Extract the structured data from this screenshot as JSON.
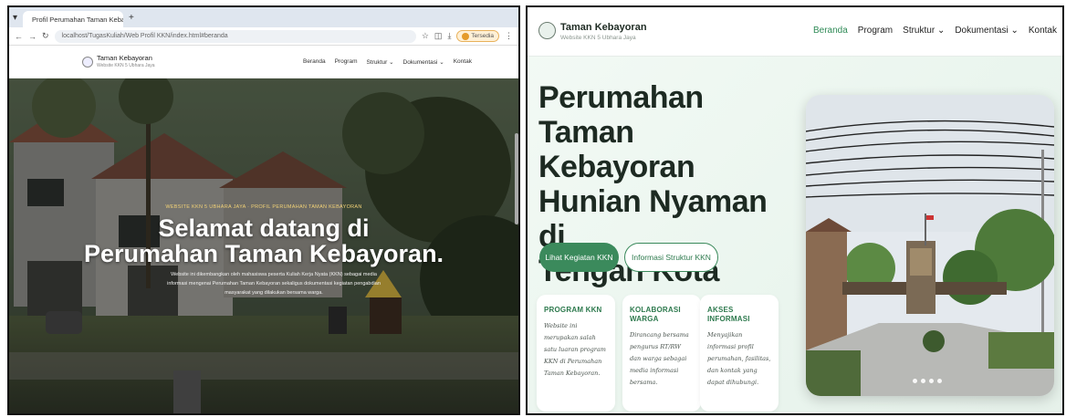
{
  "left": {
    "tab_title": "Profil Perumahan Taman Kebay",
    "tab_close": "×",
    "tab_add": "+",
    "address": "localhost/TugasKuliah/Web Profil KKN/index.html#beranda",
    "profile_label": "Tersedia",
    "nav": {
      "brand": "Taman Kebayoran",
      "sub": "Website KKN 5 Ubhara Jaya",
      "menu": [
        "Beranda",
        "Program",
        "Struktur ⌄",
        "Dokumentasi ⌄",
        "Kontak"
      ]
    },
    "hero": {
      "eyebrow": "WEBSITE KKN 5 UBHARA JAYA · PROFIL PERUMAHAN TAMAN KEBAYORAN",
      "title_line1": "Selamat datang di",
      "title_line2": "Perumahan Taman Kebayoran.",
      "desc": "Website ini dikembangkan oleh mahasiswa peserta Kuliah Kerja Nyata (KKN) sebagai media informasi mengenai Perumahan Taman Kebayoran sekaligus dokumentasi kegiatan pengabdian masyarakat yang dilakukan bersama warga."
    }
  },
  "right": {
    "brand": "Taman Kebayoran",
    "sub": "Website KKN 5 Ubhara Jaya",
    "menu": {
      "beranda": "Beranda",
      "program": "Program",
      "struktur": "Struktur ⌄",
      "dokumentasi": "Dokumentasi ⌄",
      "kontak": "Kontak"
    },
    "title": [
      "Perumahan Taman",
      "Kebayoran",
      "Hunian Nyaman di",
      "Tengah Kota"
    ],
    "btn_primary": "Lihat Kegiatan KKN",
    "btn_secondary": "Informasi Struktur KKN",
    "cards": [
      {
        "title": "PROGRAM KKN",
        "text": "Website ini merupakan salah satu luaran program KKN di Perumahan Taman Kebayoran."
      },
      {
        "title": "KOLABORASI WARGA",
        "text": "Dirancang bersama pengurus RT/RW dan warga sebagai media informasi bersama."
      },
      {
        "title": "AKSES INFORMASI",
        "text": "Menyajikan informasi profil perumahan, fasilitas, dan kontak yang dapat dihubungi."
      }
    ],
    "carousel_dots": 4
  },
  "colors": {
    "accent": "#3b8a5c",
    "active_nav": "#2e8a56",
    "eyebrow": "#f2d277"
  }
}
